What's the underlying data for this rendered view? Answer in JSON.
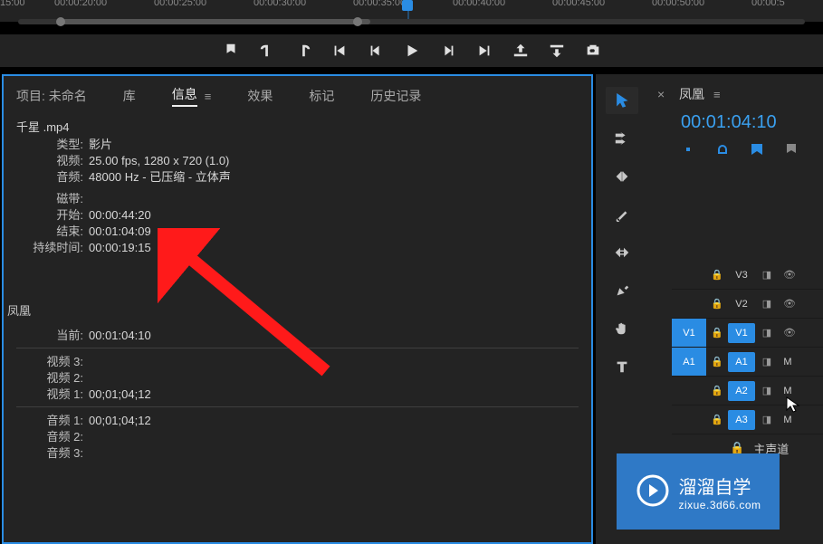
{
  "timeline": {
    "marks": [
      "15:00",
      "00:00:20:00",
      "00:00:25:00",
      "00:00:30:00",
      "00:00:35:00",
      "00:00:40:00",
      "00:00:45:00",
      "00:00:50:00",
      "00:00:5"
    ],
    "playhead_index": 4
  },
  "panel": {
    "tabs": {
      "project": "项目: 未命名",
      "library": "库",
      "info": "信息",
      "effects": "效果",
      "markers": "标记",
      "history": "历史记录"
    },
    "clip": {
      "name": "千星 .mp4",
      "type_label": "类型:",
      "type_value": "影片",
      "video_label": "视频:",
      "video_value": "25.00 fps, 1280 x 720 (1.0)",
      "audio_label": "音频:",
      "audio_value": "48000 Hz - 已压缩 - 立体声",
      "tape_label": "磁带:",
      "tape_value": "",
      "in_label": "开始:",
      "in_value": "00:00:44:20",
      "out_label": "结束:",
      "out_value": "00:01:04:09",
      "dur_label": "持续时间:",
      "dur_value": "00:00:19:15"
    },
    "seq_info": {
      "name": "凤凰",
      "current_label": "当前:",
      "current_value": "00:01:04:10",
      "v3": "视频 3:",
      "v2": "视频 2:",
      "v1": "视频 1:",
      "v1_val": "00;01;04;12",
      "a1": "音频 1:",
      "a1_val": "00;01;04;12",
      "a2": "音频 2:",
      "a3": "音频 3:"
    }
  },
  "sequence": {
    "title": "凤凰",
    "current_time": "00:01:04:10",
    "tracks": {
      "v3": "V3",
      "v2": "V2",
      "v1_src": "V1",
      "v1_tgt": "V1",
      "a1_src": "A1",
      "a1_tgt": "A1",
      "a2": "A2",
      "a3": "A3",
      "master": "主声道",
      "m": "M"
    }
  },
  "watermark": {
    "line1": "溜溜自学",
    "line2": "zixue.3d66.com"
  }
}
